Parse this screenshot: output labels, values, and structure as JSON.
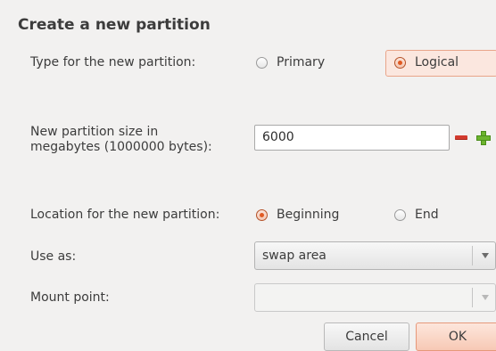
{
  "dialog": {
    "title": "Create a new partition",
    "type_label": "Type for the new partition:",
    "type_options": [
      {
        "label": "Primary",
        "checked": false
      },
      {
        "label": "Logical",
        "checked": true
      }
    ],
    "size_label_line1": "New partition size in",
    "size_label_line2": "megabytes (1000000 bytes):",
    "size_value": "6000",
    "location_label": "Location for the new partition:",
    "location_options": [
      {
        "label": "Beginning",
        "checked": true
      },
      {
        "label": "End",
        "checked": false
      }
    ],
    "use_as_label": "Use as:",
    "use_as_value": "swap area",
    "mount_point_label": "Mount point:",
    "mount_point_value": "",
    "cancel_label": "Cancel",
    "ok_label": "OK"
  },
  "icons": [
    "minus-icon",
    "plus-icon",
    "dropdown-arrow-icon"
  ],
  "colors": {
    "background": "#f2f1f0",
    "accent": "#e05a23",
    "ok_button": "#f7c9b5",
    "minus": "#d23a2e",
    "plus": "#6cb42e"
  }
}
